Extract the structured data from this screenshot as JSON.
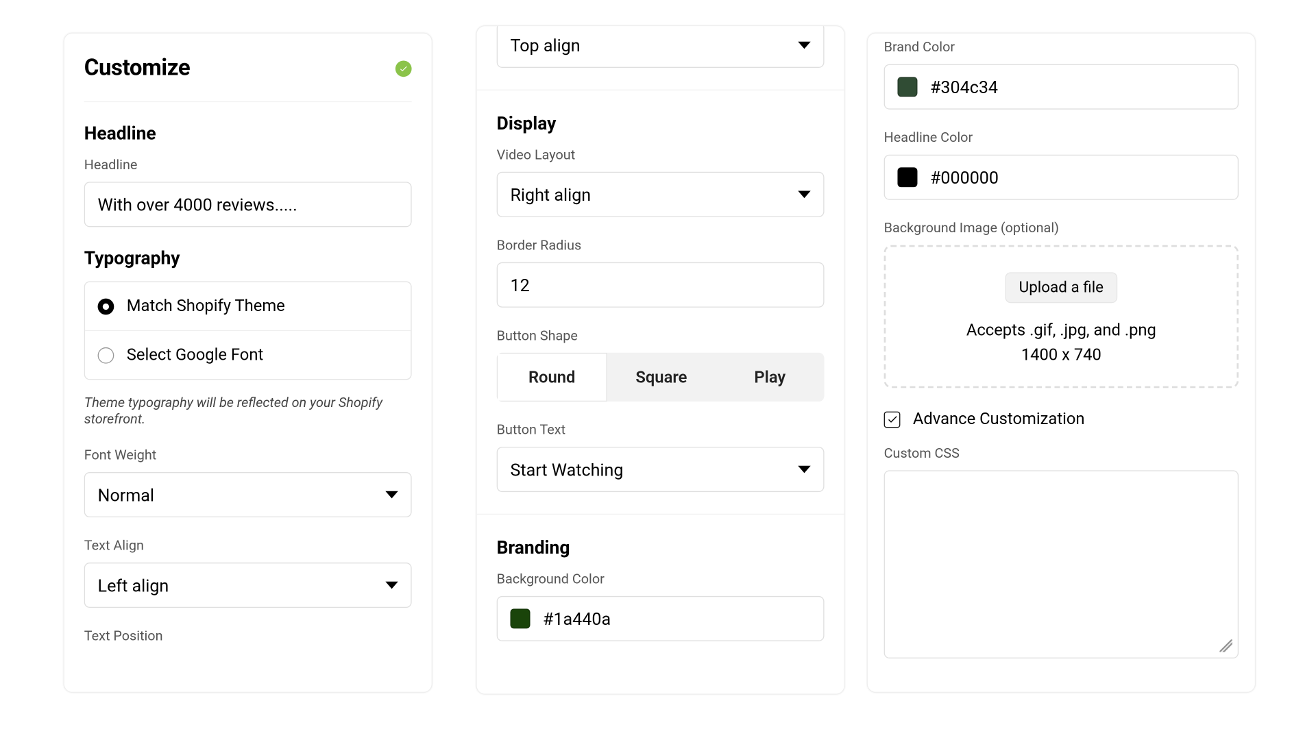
{
  "panel_title": "Customize",
  "headline": {
    "section": "Headline",
    "label": "Headline",
    "value": "With over 4000 reviews....."
  },
  "typography": {
    "section": "Typography",
    "options": {
      "match": "Match Shopify Theme",
      "google": "Select Google Font"
    },
    "hint": "Theme typography will be reflected on your Shopify storefront."
  },
  "font_weight": {
    "label": "Font Weight",
    "value": "Normal"
  },
  "text_align": {
    "label": "Text Align",
    "value": "Left align"
  },
  "text_position": {
    "label": "Text Position",
    "value": "Top align"
  },
  "display": {
    "section": "Display",
    "video_layout": {
      "label": "Video Layout",
      "value": "Right align"
    },
    "border_radius": {
      "label": "Border Radius",
      "value": "12"
    },
    "button_shape": {
      "label": "Button Shape",
      "round": "Round",
      "square": "Square",
      "play": "Play"
    },
    "button_text": {
      "label": "Button Text",
      "value": "Start Watching"
    }
  },
  "branding": {
    "section": "Branding",
    "bg": {
      "label": "Background Color",
      "value": "#1a440a",
      "swatch": "#1a440a"
    },
    "brand": {
      "label": "Brand Color",
      "value": "#304c34",
      "swatch": "#304c34"
    },
    "headline": {
      "label": "Headline Color",
      "value": "#000000",
      "swatch": "#000000"
    }
  },
  "bg_image": {
    "label": "Background Image (optional)",
    "button": "Upload a file",
    "accepts": "Accepts .gif, .jpg, and .png",
    "size": "1400 x 740"
  },
  "advanced": {
    "label": "Advance Customization",
    "css_label": "Custom CSS"
  }
}
